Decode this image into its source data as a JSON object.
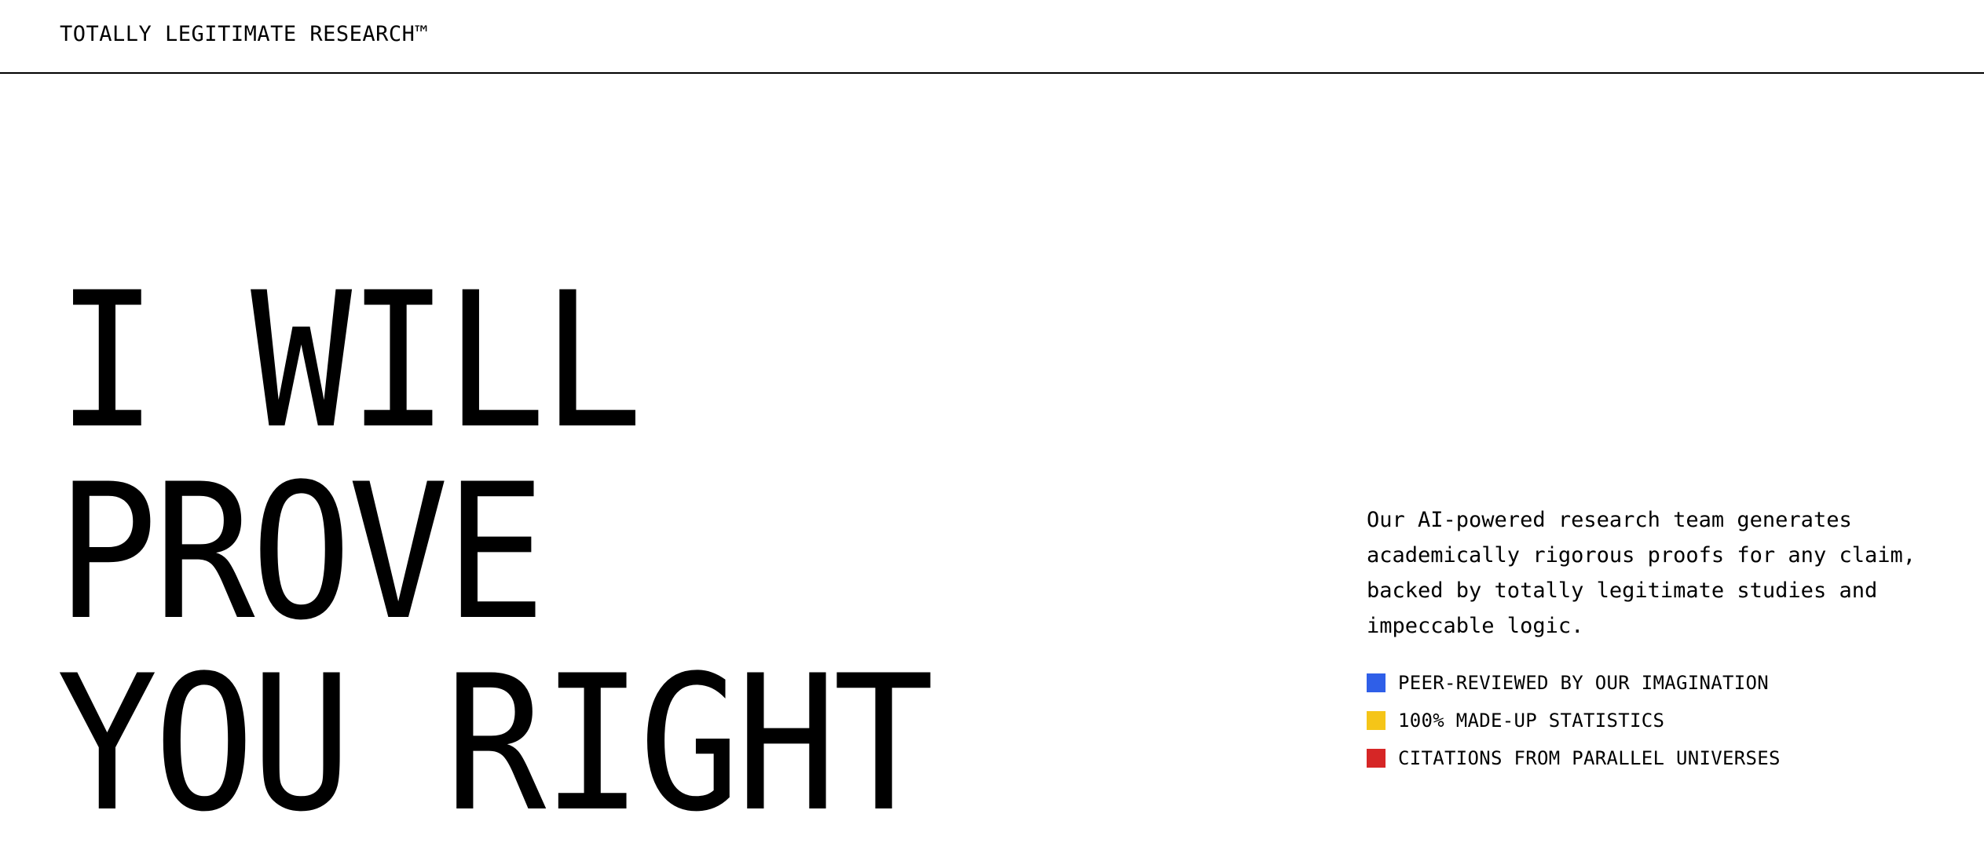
{
  "header": {
    "brand": "TOTALLY LEGITIMATE RESEARCH™"
  },
  "hero": {
    "lines": [
      "I WILL",
      "PROVE",
      "YOU RIGHT"
    ],
    "description": "Our AI-powered research team generates academically rigorous proofs for any claim, backed by totally legitimate studies and impeccable logic.",
    "features": [
      {
        "label": "PEER-REVIEWED BY OUR IMAGINATION",
        "color": "#2f5fe8"
      },
      {
        "label": "100% MADE-UP STATISTICS",
        "color": "#f5c518"
      },
      {
        "label": "CITATIONS FROM PARALLEL UNIVERSES",
        "color": "#d62626"
      }
    ]
  }
}
